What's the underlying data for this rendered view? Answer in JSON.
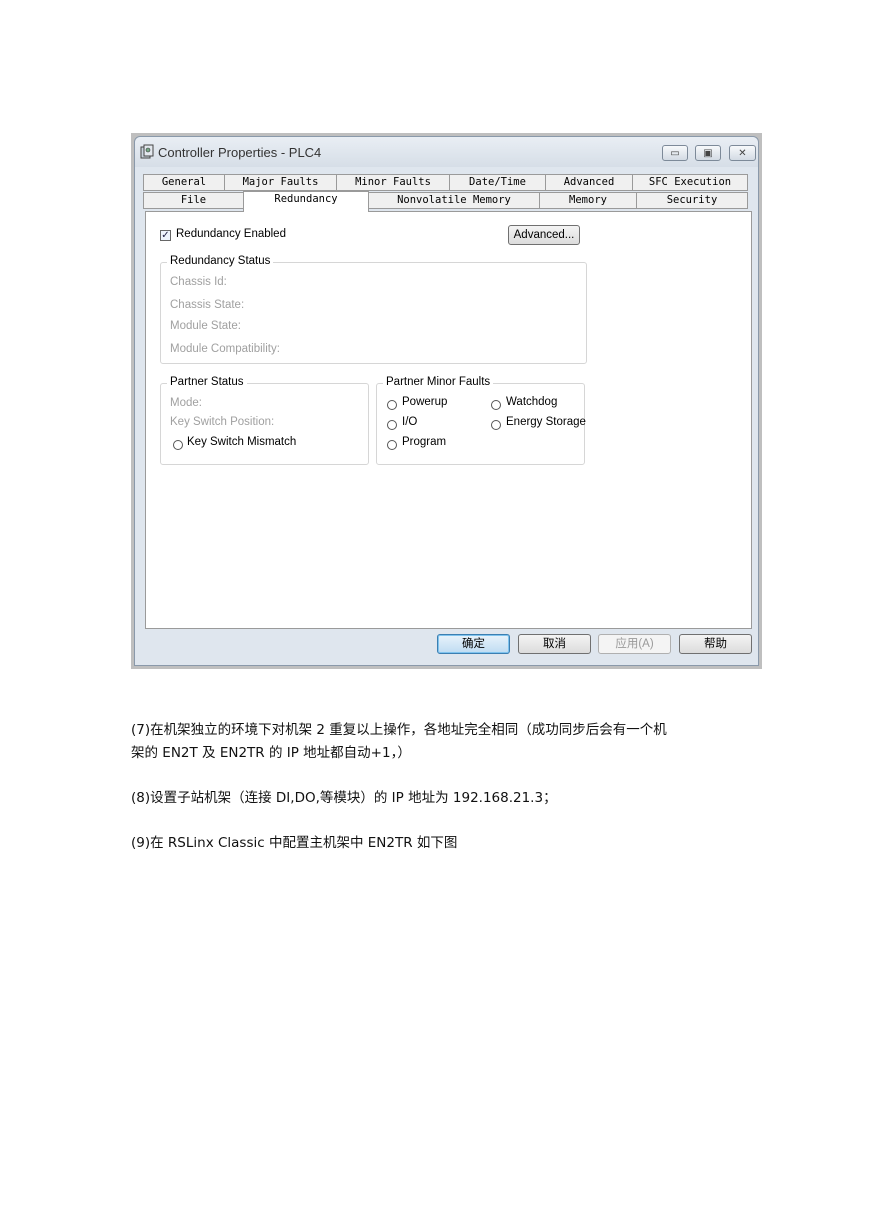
{
  "window": {
    "title": "Controller Properties - PLC4",
    "controls": {
      "minimize": "▭",
      "maximize": "▣",
      "close": "✕"
    }
  },
  "tabs_row1": [
    "General",
    "Major Faults",
    "Minor Faults",
    "Date/Time",
    "Advanced",
    "SFC Execution"
  ],
  "tabs_row2": [
    "File",
    "Redundancy",
    "Nonvolatile Memory",
    "Memory",
    "Security"
  ],
  "active_tab": "Redundancy",
  "redundancy": {
    "enabled_label": "Redundancy Enabled",
    "enabled_checked": true,
    "advanced_button": "Advanced...",
    "status_group": "Redundancy Status",
    "status_fields": [
      "Chassis Id:",
      "Chassis State:",
      "Module State:",
      "Module Compatibility:"
    ]
  },
  "partner_status": {
    "group": "Partner Status",
    "mode": "Mode:",
    "key_switch_position": "Key Switch Position:",
    "key_switch_mismatch": "Key Switch Mismatch"
  },
  "partner_minor_faults": {
    "group": "Partner Minor Faults",
    "powerup": "Powerup",
    "watchdog": "Watchdog",
    "io": "I/O",
    "energy_storage": "Energy Storage",
    "program": "Program"
  },
  "buttons": {
    "ok": "确定",
    "cancel": "取消",
    "apply": "应用(A)",
    "help": "帮助"
  },
  "document": {
    "para7_line1": "(7)在机架独立的环境下对机架 2 重复以上操作，各地址完全相同（成功同步后会有一个机",
    "para7_line2": "架的 EN2T  及 EN2TR  的 IP 地址都自动+1，）",
    "para8": "(8)设置子站机架（连接 DI,DO,等模块）的 IP 地址为 192.168.21.3；",
    "para9": "(9)在 RSLinx Classic 中配置主机架中 EN2TR 如下图"
  },
  "colors": {
    "title_bar": "#dfe6ee",
    "default_button": "#bfdcf2"
  }
}
